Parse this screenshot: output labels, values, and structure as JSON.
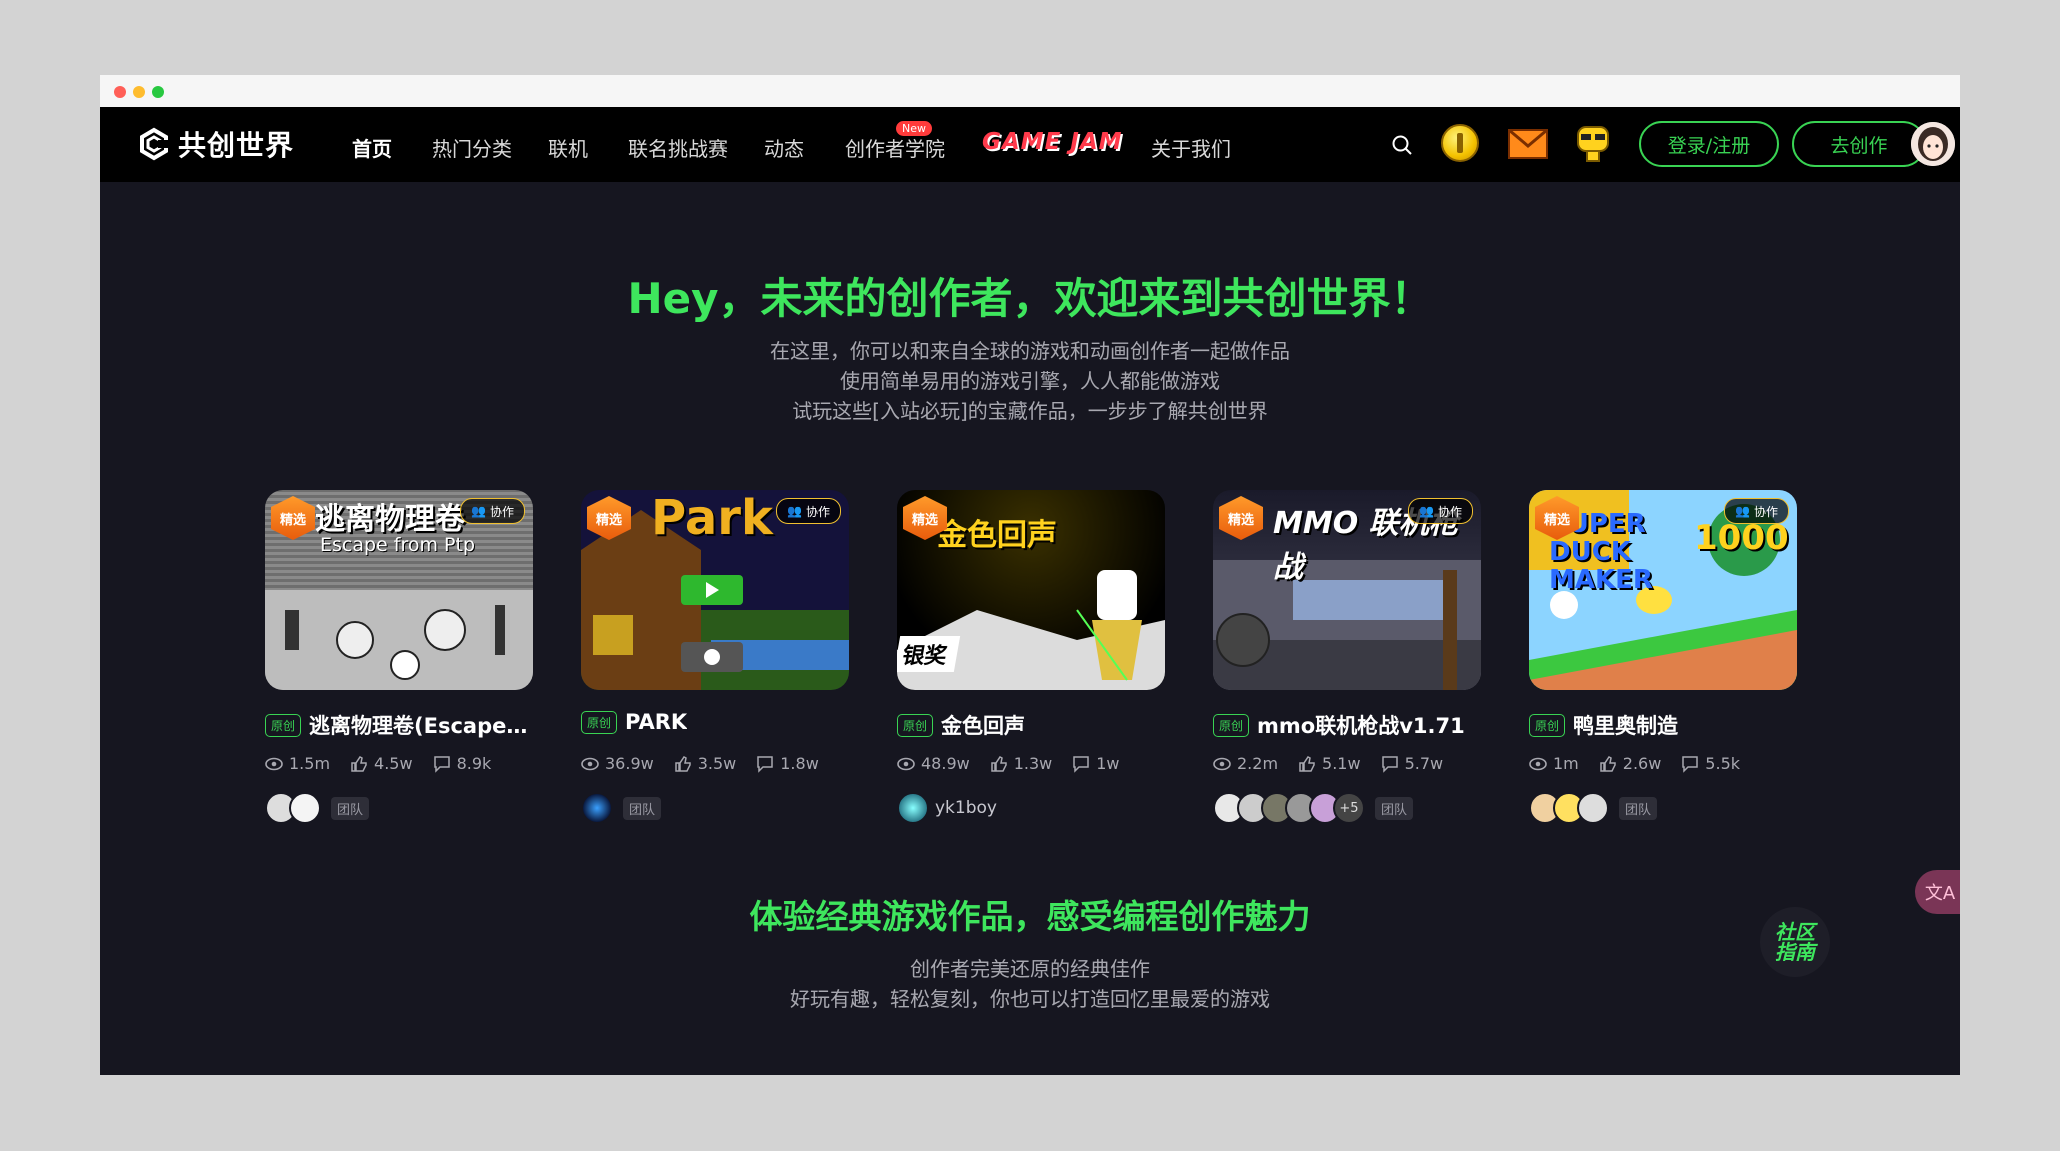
{
  "brand": {
    "name": "共创世界",
    "accent": "#3ee65d"
  },
  "nav": {
    "items": [
      {
        "label": "首页"
      },
      {
        "label": "热门分类"
      },
      {
        "label": "联机"
      },
      {
        "label": "联名挑战赛"
      },
      {
        "label": "动态"
      },
      {
        "label": "创作者学院"
      },
      {
        "label": "GAME JAM"
      },
      {
        "label": "关于我们"
      }
    ],
    "new_badge": "New",
    "login_label": "登录/注册",
    "create_label": "去创作",
    "icons": [
      "search-icon",
      "coin-icon",
      "mail-icon",
      "robot-icon"
    ]
  },
  "hero": {
    "title": "Hey，未来的创作者，欢迎来到共创世界！",
    "lines": [
      "在这里，你可以和来自全球的游戏和动画创作者一起做作品",
      "使用简单易用的游戏引擎，人人都能做游戏",
      "试玩这些[入站必玩]的宝藏作品，一步步了解共创世界"
    ]
  },
  "labels": {
    "featured": "精选",
    "collab": "协作",
    "original": "原创",
    "team": "团队"
  },
  "cards": [
    {
      "name": "逃离物理卷(Escape ...",
      "thumb_title": "逃离物理卷",
      "thumb_subtitle": "Escape from Ptp",
      "views": "1.5m",
      "likes": "4.5w",
      "comments": "8.9k"
    },
    {
      "name": "PARK",
      "thumb_title": "Park",
      "views": "36.9w",
      "likes": "3.5w",
      "comments": "1.8w"
    },
    {
      "name": "金色回声",
      "thumb_title": "金色回声",
      "tag": "银奖",
      "views": "48.9w",
      "likes": "1.3w",
      "comments": "1w",
      "author": "yk1boy"
    },
    {
      "name": "mmo联机枪战v1.71",
      "thumb_title": "MMO 联机枪战",
      "views": "2.2m",
      "likes": "5.1w",
      "comments": "5.7w",
      "more_authors": "+5"
    },
    {
      "name": "鸭里奥制造",
      "thumb_title": "SUPER DUCK MAKER",
      "thumb_badge": "1000",
      "views": "1m",
      "likes": "2.6w",
      "comments": "5.5k"
    }
  ],
  "section2": {
    "title": "体验经典游戏作品，感受编程创作魅力",
    "lines": [
      "创作者完美还原的经典佳作",
      "好玩有趣，轻松复刻，你也可以打造回忆里最爱的游戏"
    ]
  },
  "floating": {
    "lang": "文A",
    "guide": "社区指南"
  }
}
